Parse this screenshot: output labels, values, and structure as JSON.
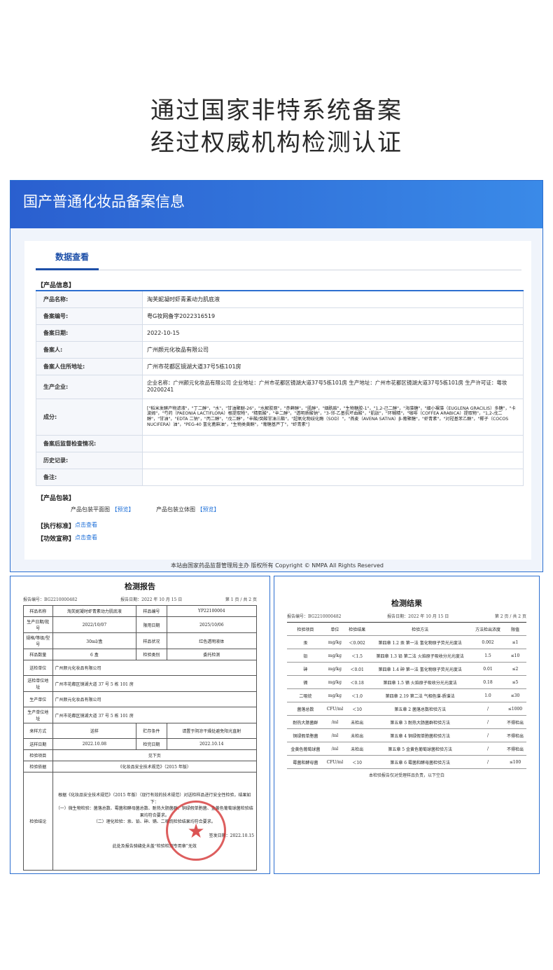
{
  "headline": {
    "line1": "通过国家非特系统备案",
    "line2": "经过权威机构检测认证"
  },
  "panel": {
    "banner_title": "国产普通化妆品备案信息",
    "tab": "数据查看",
    "section_product": "【产品信息】",
    "rows": [
      {
        "key": "产品名称:",
        "value": "淘芙妮凝时虾青素动力肌底液"
      },
      {
        "key": "备案编号:",
        "value": "粤G妆网备字2022316519"
      },
      {
        "key": "备案日期:",
        "value": "2022-10-15"
      },
      {
        "key": "备案人:",
        "value": "广州颜元化妆品有限公司"
      },
      {
        "key": "备案人住所地址:",
        "value": "广州市花都区镜湖大道37号5栋101房"
      },
      {
        "key": "生产企业:",
        "value": "企业名称：广州颜元化妆品有限公司 企业地址：广州市花都区镜湖大道37号5栋101房 生产地址：广州市花都区镜湖大道37号5栋101房 生产许可证：粤妆20200241"
      },
      {
        "key": "成分:",
        "value": "[\"稻米发酵产物滤液\"，\"丁二醇\"，\"水\"，\"甘油聚醚-26\"，\"水解胶原\"，\"赤藓醇\"，\"肌醇\"，\"烟酰胺\"，\"生物糖胶-1\"，\"1,2-己二醇\"，\"海藻糖\"，\"细小裸藻（EUGLENA GRACILIS）多糖\"，\"卡波姆\"，\"芍药（PAEONIA LACTIFLORA）根提取物\"，\"精氨酸\"，\"辛二醇\"，\"透明质酸钠\"，\"3-邻-乙基抗坏血酸\"，\"肌肽\"，\"环糊精\"，\"咖啡（COFFEA ARABICA）提取物\"，\"1,2-戊二醇\"，\"甘油\"，\"EDTA 二钠\"，\"丙二醇\"，\"戊二醇\"，\"辛酸/癸酸甘油三酯\"，\"超氧化物歧化酶（SOD）\"，\"燕麦（AVENA SATIVA）β-葡聚糖\"，\"虾青素\"，\"对羟基苯乙酮\"，\"椰子（COCOS NUCIFERA）油\"，\"PEG-40 氢化蓖麻油\"，\"生物类黄酮\"，\"葡糖基芦丁\"，\"虾青素\"]"
      },
      {
        "key": "备案后监督检查情况:",
        "value": ""
      },
      {
        "key": "历史记录:",
        "value": ""
      },
      {
        "key": "备注:",
        "value": ""
      }
    ],
    "section_package": "【产品包装】",
    "pkg_flat": "产品包装平面图",
    "pkg_3d": "产品包装立体图",
    "preview": "【预览】",
    "section_standard": "【执行标准】",
    "section_claims": "【功效宣称】",
    "click_view": "点击查看",
    "footer": "本站由国家药品监督管理局主办 版权所有 Copyright © NMPA All Rights Reserved"
  },
  "report1": {
    "title": "检测报告",
    "no": "报告编号：BG2210000482",
    "date": "报告日期：2022 年 10 月 15 日",
    "page": "第 1 页 / 共 2 页",
    "r_name_k": "样品名称",
    "r_name_v": "淘芙妮凝时虾青素动力肌底液",
    "r_no_k": "样品编号",
    "r_no_v": "YP22100004",
    "r_batch_k": "生产日期/批号",
    "r_batch_v": "2022/10/07",
    "r_exp_k": "限用日期",
    "r_exp_v": "2025/10/06",
    "r_spec_k": "规格/等级/型号",
    "r_spec_v": "30ml/盒",
    "r_state_k": "样品状况",
    "r_state_v": "红色透明液体",
    "r_qty_k": "样品数量",
    "r_qty_v": "6 盒",
    "r_type_k": "检验类别",
    "r_type_v": "委托检测",
    "r_sender_k": "送检单位",
    "r_sender_v": "广州颜元化妆品有限公司",
    "r_senderaddr_k": "送检单位地址",
    "r_senderaddr_v": "广州市花都区镜湖大道 37 号 5 栋 101 房",
    "r_maker_k": "生产单位",
    "r_maker_v": "广州颜元化妆品有限公司",
    "r_makeraddr_k": "生产单位地址",
    "r_makeraddr_v": "广州市花都区镜湖大道 37 号 5 栋 101 房",
    "r_sample_k": "来样方式",
    "r_sample_v": "送样",
    "r_store_k": "贮存条件",
    "r_store_v": "请置于阴凉干燥处避免阳光直射",
    "r_recv_k": "送样日期",
    "r_recv_v": "2022.10.08",
    "r_done_k": "检完日期",
    "r_done_v": "2022.10.14",
    "r_item_k": "检验项目",
    "r_item_v": "见下页",
    "r_basis_k": "检验依据",
    "r_basis_v": "《化妆品安全技术规范》（2015 年版）",
    "r_concl_k": "检验结论",
    "r_concl_1": "根据《化妆品安全技术规范》（2015 年版）（现行有效的技术规范）对送检样品进行安全性检验，结果如下：",
    "r_concl_2": "（一）微生物检验：菌落总数、霉菌和酵母菌总数、耐热大肠菌群、铜绿假单胞菌、金黄色葡萄球菌检验结果均符合要求。",
    "r_concl_3": "（二）理化检验：汞、铅、砷、镉、二噁烷检验结果均符合要求。",
    "r_sign": "签发日期：2022.10.15",
    "r_note": "此处及报告骑缝处未盖“检验检测专用章”无效"
  },
  "report2": {
    "title": "检测结果",
    "no": "报告编号：BG2210000482",
    "date": "报告日期：2022 年 10 月 15 日",
    "page": "第 2 页 / 共 2 页",
    "headers": [
      "检验项目",
      "单位",
      "检验结果",
      "检验方法",
      "方法检出浓度",
      "限值"
    ],
    "rows": [
      [
        "汞",
        "mg/kg",
        "＜0.002",
        "第四章 1.2 汞 第一法 氢化物原子荧光光度法",
        "0.002",
        "≤1"
      ],
      [
        "铅",
        "mg/kg",
        "＜1.5",
        "第四章 1.3 铅 第二法 火焰原子吸收分光光度法",
        "1.5",
        "≤10"
      ],
      [
        "砷",
        "mg/kg",
        "＜0.01",
        "第四章 1.4 砷 第一法 氢化物原子荧光光度法",
        "0.01",
        "≤2"
      ],
      [
        "镉",
        "mg/kg",
        "＜0.18",
        "第四章 1.5 镉 火焰原子吸收分光光度法",
        "0.18",
        "≤5"
      ],
      [
        "二噁烷",
        "mg/kg",
        "＜1.0",
        "第四章 2.19 第二法 气相色谱-质谱法",
        "1.0",
        "≤30"
      ],
      [
        "菌落总数",
        "CFU/ml",
        "＜10",
        "第五章 2 菌落总数检验方法",
        "/",
        "≤1000"
      ],
      [
        "耐热大肠菌群",
        "/ml",
        "未检出",
        "第五章 3 耐热大肠菌群检验方法",
        "/",
        "不得检出"
      ],
      [
        "铜绿假单胞菌",
        "/ml",
        "未检出",
        "第五章 4 铜绿假单胞菌检验方法",
        "/",
        "不得检出"
      ],
      [
        "金黄色葡萄球菌",
        "/ml",
        "未检出",
        "第五章 5 金黄色葡萄球菌检验方法",
        "/",
        "不得检出"
      ],
      [
        "霉菌和酵母菌",
        "CFU/ml",
        "＜10",
        "第五章 6 霉菌和酵母菌检验方法",
        "/",
        "≤100"
      ]
    ],
    "note": "本检验报告仅对受理样品负责，以下空白"
  }
}
